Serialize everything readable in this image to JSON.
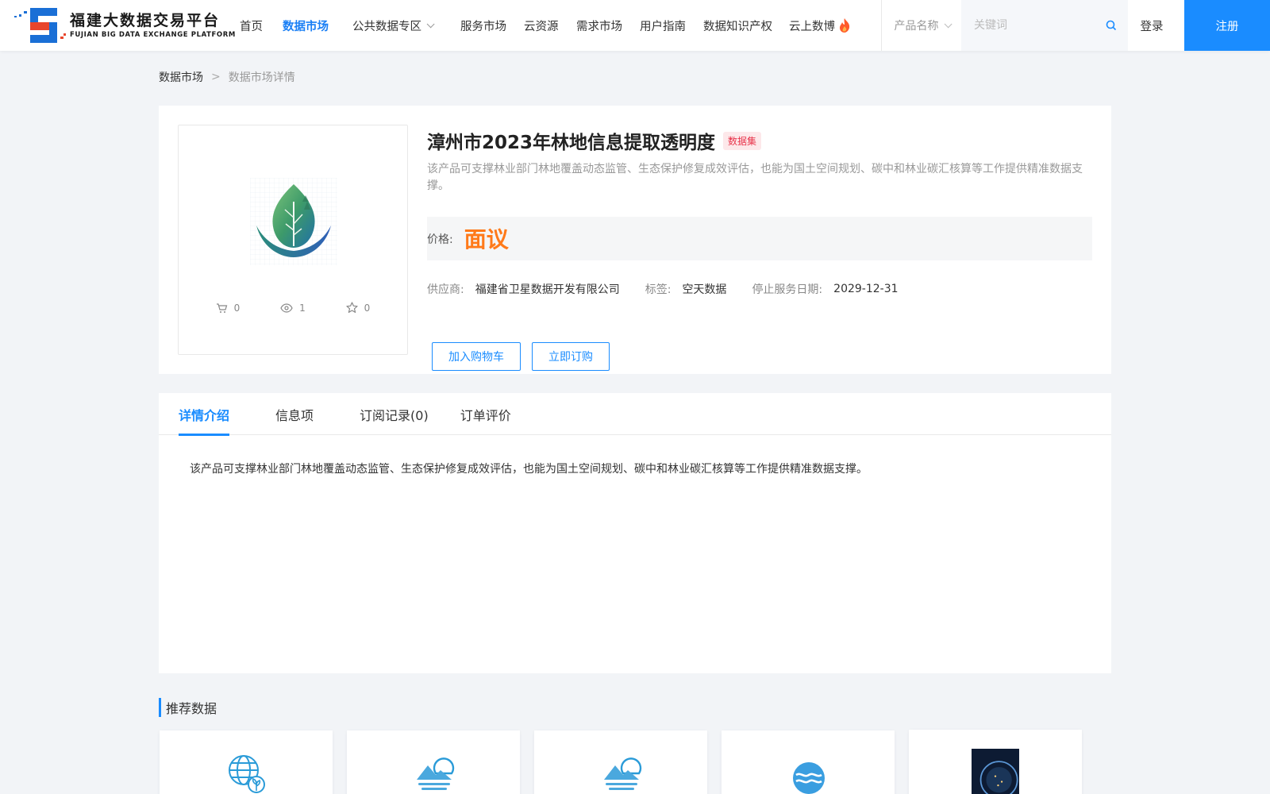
{
  "header": {
    "logo_cn": "福建大数据交易平台",
    "logo_en": "FUJIAN BIG DATA EXCHANGE  PLATFORM",
    "nav": [
      {
        "label": "首页"
      },
      {
        "label": "数据市场"
      },
      {
        "label": "公共数据专区"
      },
      {
        "label": "服务市场"
      },
      {
        "label": "云资源"
      },
      {
        "label": "需求市场"
      },
      {
        "label": "用户指南"
      },
      {
        "label": "数据知识产权"
      },
      {
        "label": "云上数博"
      }
    ],
    "search_type": "产品名称",
    "search_placeholder": "关键词",
    "login": "登录",
    "register": "注册",
    "accent_color": "#1a8cff"
  },
  "breadcrumb": {
    "root": "数据市场",
    "separator": ">",
    "current": "数据市场详情"
  },
  "product": {
    "title": "漳州市2023年林地信息提取透明度",
    "badge": "数据集",
    "description": "该产品可支撑林业部门林地覆盖动态监管、生态保护修复成效评估，也能为国土空间规划、碳中和林业碳汇核算等工作提供精准数据支撑。",
    "price_label": "价格:",
    "price": "面议",
    "supplier_label": "供应商:",
    "supplier": "福建省卫星数据开发有限公司",
    "tag_label": "标签:",
    "tag": "空天数据",
    "end_date_label": "停止服务日期:",
    "end_date": "2029-12-31",
    "stats": {
      "cart": "0",
      "views": "1",
      "favorites": "0"
    },
    "add_cart_label": "加入购物车",
    "buy_now_label": "立即订购"
  },
  "tabs": [
    {
      "label": "详情介绍"
    },
    {
      "label": "信息项"
    },
    {
      "label": "订阅记录(0)"
    },
    {
      "label": "订单评价"
    }
  ],
  "detail_text": "该产品可支撑林业部门林地覆盖动态监管、生态保护修复成效评估，也能为国土空间规划、碳中和林业碳汇核算等工作提供精准数据支撑。",
  "recommended": {
    "title": "推荐数据",
    "icons": [
      "globe-plant-icon",
      "sun-mountain-icon",
      "sun-mountain-icon",
      "water-wave-icon",
      "night-globe-image"
    ]
  }
}
